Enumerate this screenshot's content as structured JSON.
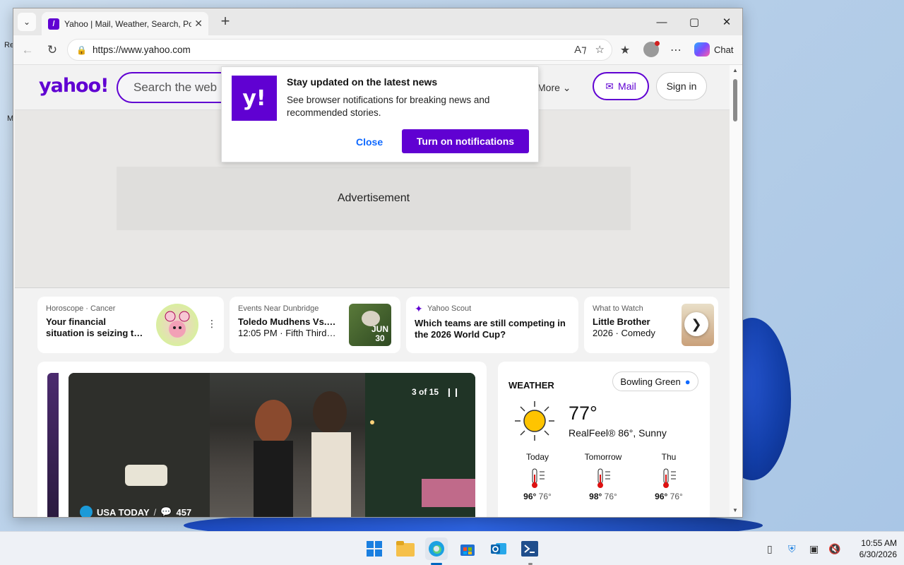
{
  "browser": {
    "tab_title": "Yahoo | Mail, Weather, Search, Politics",
    "url": "https://www.yahoo.com",
    "chat_label": "Chat"
  },
  "desktop": {
    "left_fragments": [
      "Re",
      "M"
    ]
  },
  "header": {
    "logo": "yahoo!",
    "search_placeholder": "Search the web",
    "more_label": "More",
    "mail_label": "Mail",
    "signin_label": "Sign in"
  },
  "notification": {
    "logo": "y!",
    "title": "Stay updated on the latest news",
    "body": "See browser notifications for breaking news and recommended stories.",
    "close_label": "Close",
    "turn_on_label": "Turn on notifications"
  },
  "ad": {
    "label": "Advertisement"
  },
  "cards": [
    {
      "kicker": "Horoscope · Cancer",
      "headline": "Your financial situation is seizing t…"
    },
    {
      "kicker": "Events Near Dunbridge",
      "headline": "Toledo Mudhens Vs.…",
      "sub": "12:05 PM · Fifth Third…",
      "badge_month": "JUN",
      "badge_day": "30"
    },
    {
      "kicker": "Yahoo Scout",
      "headline": "Which teams are still competing in the 2026 World Cup?"
    },
    {
      "kicker": "What to Watch",
      "headline": "Little Brother",
      "sub": "2026 · Comedy"
    }
  ],
  "gallery": {
    "counter": "3 of 15",
    "source": "USA TODAY",
    "separator": "/",
    "comments": "457"
  },
  "weather": {
    "title": "WEATHER",
    "location": "Bowling Green",
    "temp": "77°",
    "realfeel": "RealFeel® 86°, Sunny",
    "days": [
      {
        "name": "Today",
        "high": "96°",
        "low": "76°"
      },
      {
        "name": "Tomorrow",
        "high": "98°",
        "low": "76°"
      },
      {
        "name": "Thu",
        "high": "96°",
        "low": "76°"
      }
    ]
  },
  "taskbar": {
    "time": "10:55 AM",
    "date": "6/30/2026"
  },
  "icons": {
    "tab_menu": "chevron-down-icon",
    "back": "back-arrow-icon",
    "refresh": "refresh-icon",
    "lock": "lock-icon",
    "read_aloud": "read-aloud-icon",
    "favorite": "star-icon",
    "collections": "favorites-icon",
    "more": "more-icon"
  },
  "colors": {
    "yahoo_purple": "#6001d2",
    "link_blue": "#0f69ff"
  }
}
